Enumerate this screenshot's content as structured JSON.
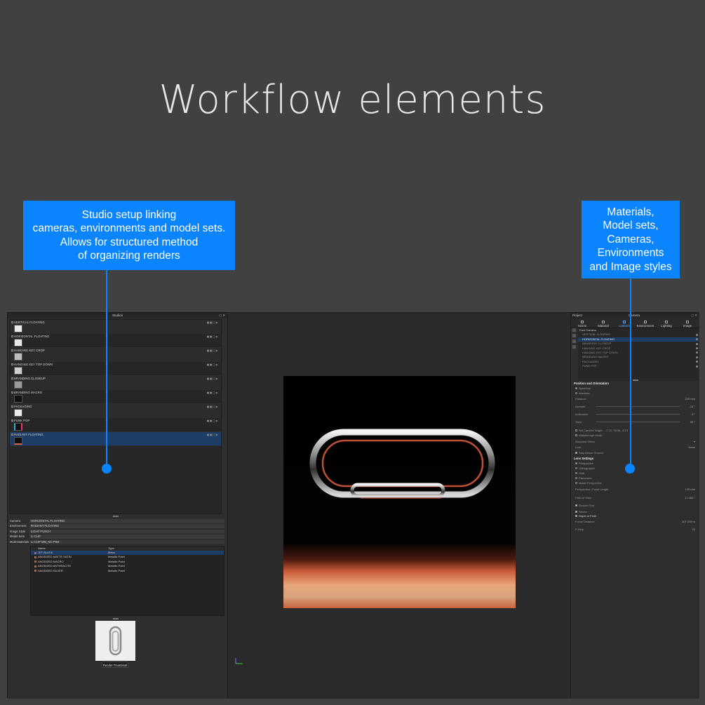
{
  "heading": "Workflow elements",
  "callouts": {
    "left": "Studio setup linking\ncameras, environments and model sets.\nAllows for structured method\nof organizing renders",
    "right": "Materials,\nModel sets,\nCameras,\nEnvironments\nand Image styles"
  },
  "colors": {
    "accent": "#0a84ff",
    "background": "#414141",
    "selection": "#1d3c66"
  },
  "studio": {
    "title": "Studios",
    "items": [
      {
        "label": "VERTICAL FLOATING"
      },
      {
        "label": "HORIZONTAL FLOATING"
      },
      {
        "label": "HANGING KEY CROP"
      },
      {
        "label": "HANGING KEY TOP DOWN"
      },
      {
        "label": "BRANDING CLOSEUP"
      },
      {
        "label": "BRANDING MACRO"
      },
      {
        "label": "PACKAGING"
      },
      {
        "label": "PUNK POP"
      },
      {
        "label": "RADIANT FLOATING"
      }
    ],
    "selected": "RADIANT FLOATING"
  },
  "properties": [
    {
      "key": "Camera",
      "value": "HORIZONTAL FLOATING"
    },
    {
      "key": "Environment",
      "value": "RADIANT FLOATING"
    },
    {
      "key": "Image Style",
      "value": "LIGHT PUNCH"
    },
    {
      "key": "Model Sets",
      "value": "LI CLIP"
    },
    {
      "key": "Multi-Materials",
      "value": "LI CLIP MM_NO PSD"
    }
  ],
  "materials": {
    "columns": [
      "Name",
      "Type"
    ],
    "rows": [
      {
        "name": "JET BLACK",
        "type": "Metal"
      },
      {
        "name": "ANODIZED MATTE SATIN",
        "type": "Metallic Paint"
      },
      {
        "name": "ANODIZED MACRO",
        "type": "Metallic Paint"
      },
      {
        "name": "ANODIZED ANTHRACITE",
        "type": "Metallic Paint"
      },
      {
        "name": "ANODIZED SILVER",
        "type": "Metallic Paint"
      }
    ]
  },
  "render_button": "Render Thumbnail",
  "right_panel": {
    "left_header": "Project",
    "title": "Camera",
    "tabs": [
      "Scene",
      "Material",
      "Camera",
      "Environment",
      "Lighting",
      "Image"
    ],
    "active_tab": "Camera",
    "cameras": [
      {
        "label": "Free Camera"
      },
      {
        "label": "VERTICAL FLOATING"
      },
      {
        "label": "HORIZONTAL FLOATING"
      },
      {
        "label": "BRANDING CLOSEUP"
      },
      {
        "label": "HANGING KEY CROP"
      },
      {
        "label": "HANGING KEY TOP DOWN"
      },
      {
        "label": "BRANDING MACRO"
      },
      {
        "label": "PACKAGING"
      },
      {
        "label": "PUNK POP"
      }
    ],
    "section_position": "Position and Orientation",
    "spherical": "Spherical",
    "absolute": "Absolute",
    "distance_label": "Distance",
    "distance_value": "200 mm",
    "azimuth_label": "Azimuth",
    "azimuth_value": "-15 °",
    "inclination_label": "Inclination",
    "inclination_value": "0 °",
    "twist_label": "Twist",
    "twist_value": "90 °",
    "set_target_label": "Set Camera Target",
    "set_target_value": "-7.74, 76.06, -6.23",
    "walkthrough": "Walkthrough Mode",
    "standard_views": "Standard Views",
    "lock_label": "Lock",
    "lock_value": "None",
    "stay_above": "Stay Above Ground",
    "section_lens": "Lens Settings",
    "perspective": "Perspective",
    "orthographic": "Orthographic",
    "shift": "Shift",
    "panoramic": "Panoramic",
    "match_perspective": "Match Perspective",
    "focal_label": "Perspective / Focal Length",
    "focal_value": "120 mm",
    "fov_label": "Field of View",
    "fov_value": "17.062 °",
    "ground_grid": "Ground Grid",
    "stereo": "Stereo",
    "dof": "Depth of Field",
    "focus_label": "Focus Distance",
    "focus_value": "307.239 m",
    "fstop_label": "F-Stop",
    "fstop_value": "20"
  }
}
